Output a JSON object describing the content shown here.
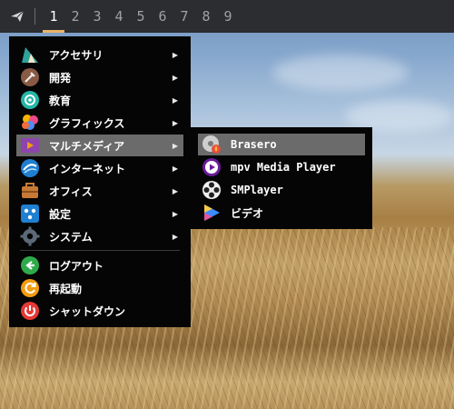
{
  "topbar": {
    "launcher_icon": "paper-plane-icon",
    "workspaces": [
      "1",
      "2",
      "3",
      "4",
      "5",
      "6",
      "7",
      "8",
      "9"
    ],
    "active_workspace": "1",
    "accent": "#e9b36a"
  },
  "menu": {
    "items": [
      {
        "label": "アクセサリ",
        "icon": "accessories-icon",
        "submenu": true
      },
      {
        "label": "開発",
        "icon": "development-icon",
        "submenu": true
      },
      {
        "label": "教育",
        "icon": "education-icon",
        "submenu": true
      },
      {
        "label": "グラフィックス",
        "icon": "graphics-icon",
        "submenu": true
      },
      {
        "label": "マルチメディア",
        "icon": "multimedia-icon",
        "submenu": true
      },
      {
        "label": "インターネット",
        "icon": "internet-icon",
        "submenu": true
      },
      {
        "label": "オフィス",
        "icon": "office-icon",
        "submenu": true
      },
      {
        "label": "設定",
        "icon": "settings-icon",
        "submenu": true
      },
      {
        "label": "システム",
        "icon": "system-icon",
        "submenu": true
      }
    ],
    "actions": [
      {
        "label": "ログアウト",
        "icon": "logout-icon"
      },
      {
        "label": "再起動",
        "icon": "restart-icon"
      },
      {
        "label": "シャットダウン",
        "icon": "shutdown-icon"
      }
    ],
    "highlighted": "マルチメディア",
    "arrow": "▶"
  },
  "submenu": {
    "items": [
      {
        "label": "Brasero",
        "icon": "brasero-icon"
      },
      {
        "label": "mpv Media Player",
        "icon": "mpv-icon"
      },
      {
        "label": "SMPlayer",
        "icon": "smplayer-icon"
      },
      {
        "label": "ビデオ",
        "icon": "videos-icon"
      }
    ],
    "highlighted": "Brasero"
  }
}
